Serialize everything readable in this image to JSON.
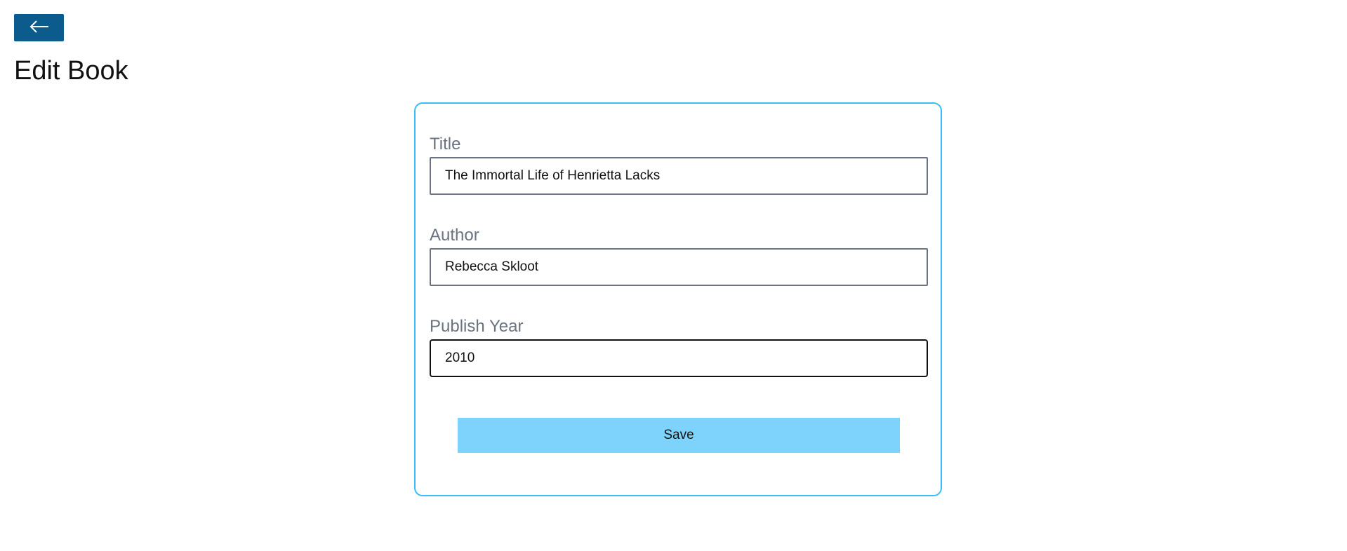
{
  "header": {
    "back_icon": "arrow-left-icon",
    "title": "Edit Book"
  },
  "form": {
    "fields": [
      {
        "label": "Title",
        "value": "The Immortal Life of Henrietta Lacks"
      },
      {
        "label": "Author",
        "value": "Rebecca Skloot"
      },
      {
        "label": "Publish Year",
        "value": "2010"
      }
    ],
    "save_label": "Save"
  },
  "colors": {
    "back_button": "#0b5b8c",
    "card_border": "#38bdf8",
    "save_button": "#7dd3fc",
    "label_text": "#6b7280"
  }
}
